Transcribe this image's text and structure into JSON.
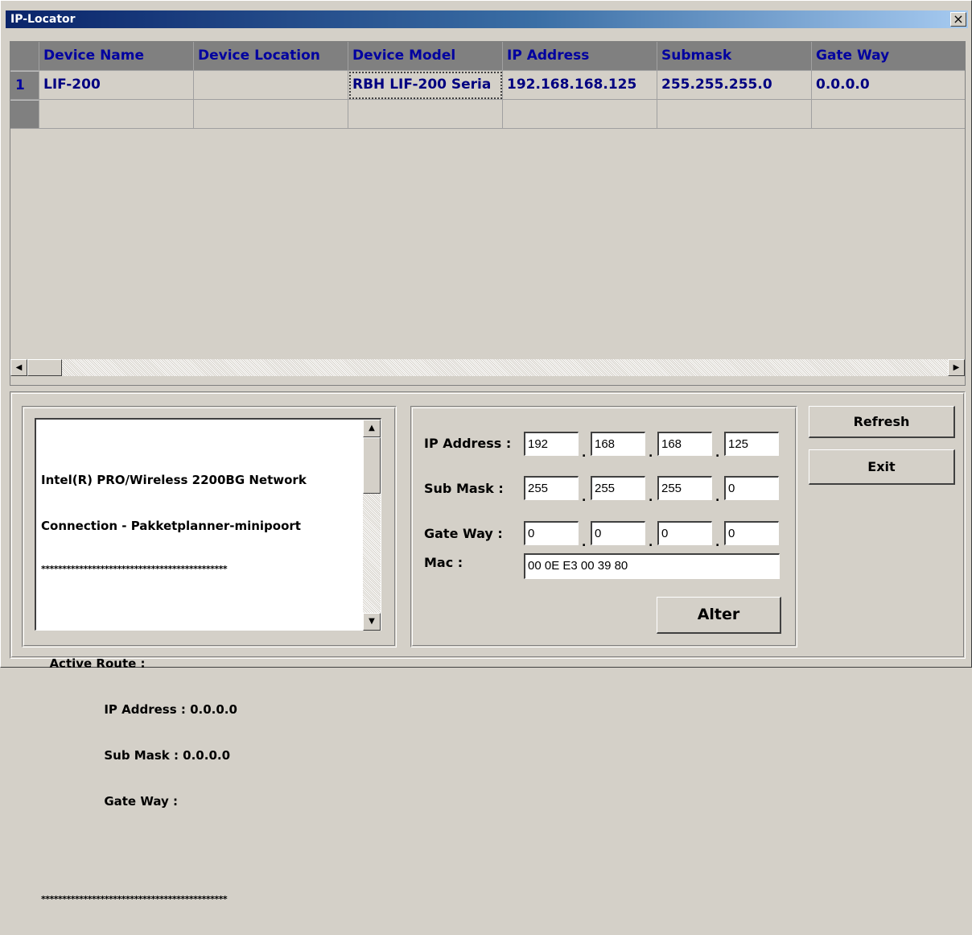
{
  "window": {
    "title": "IP-Locator",
    "close_glyph": "×"
  },
  "grid": {
    "columns": [
      "Device Name",
      "Device Location",
      "Device Model",
      "IP Address",
      "Submask",
      "Gate Way"
    ],
    "rows": [
      {
        "num": "1",
        "cells": [
          "LIF-200",
          "",
          "RBH LIF-200 Seria",
          "192.168.168.125",
          "255.255.255.0",
          "0.0.0.0"
        ]
      },
      {
        "num": "",
        "cells": [
          "",
          "",
          "",
          "",
          "",
          ""
        ]
      }
    ]
  },
  "info": {
    "lines": [
      "Intel(R) PRO/Wireless 2200BG Network",
      "Connection - Pakketplanner-minipoort",
      "********************************************",
      "",
      "  Active Route :",
      "               IP Address : 0.0.0.0",
      "               Sub Mask : 0.0.0.0",
      "               Gate Way :",
      "",
      "********************************************"
    ]
  },
  "form": {
    "ip_label": "IP Address :",
    "ip": [
      "192",
      "168",
      "168",
      "125"
    ],
    "mask_label": "Sub Mask :",
    "mask": [
      "255",
      "255",
      "255",
      "0"
    ],
    "gw_label": "Gate Way :",
    "gw": [
      "0",
      "0",
      "0",
      "0"
    ],
    "mac_label": "Mac :",
    "mac": "00 0E E3 00 39 80",
    "separator": "."
  },
  "buttons": {
    "alter": "Alter",
    "refresh": "Refresh",
    "exit": "Exit"
  },
  "scroll_arrows": {
    "left": "◀",
    "right": "▶",
    "up": "▲",
    "down": "▼"
  }
}
